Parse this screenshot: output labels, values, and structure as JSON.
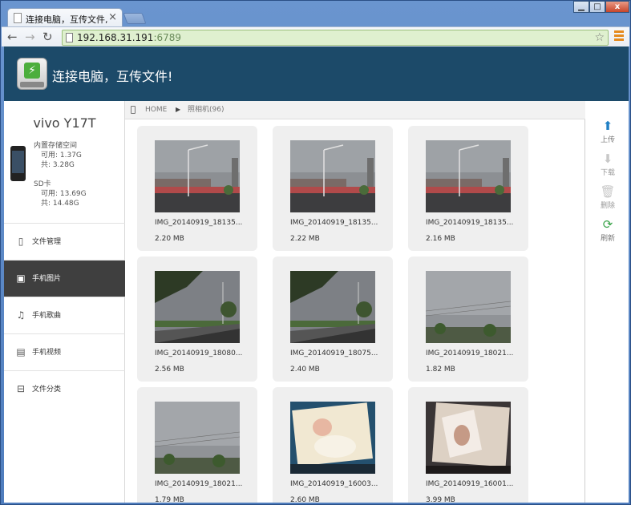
{
  "browser": {
    "tab_title": "连接电脑，互传文件,",
    "close_glyph": "×",
    "url_host": "192.168.31.191",
    "url_port": ":6789",
    "back_glyph": "←",
    "forward_glyph": "→",
    "reload_glyph": "↻",
    "star_glyph": "☆",
    "min_glyph": "▁",
    "max_glyph": "□",
    "close_win_glyph": "x"
  },
  "app": {
    "header_title": "连接电脑，互传文件!",
    "logo_glyph": "⚡",
    "device_name": "vivo Y17T",
    "internal_storage": {
      "label": "内置存储空间",
      "available": "可用: 1.37G",
      "total": "共: 3.28G"
    },
    "sd_card": {
      "label": "SD卡",
      "available": "可用: 13.69G",
      "total": "共: 14.48G"
    },
    "nav": [
      {
        "label": "文件管理",
        "icon": "phone-icon",
        "glyph": "▯"
      },
      {
        "label": "手机图片",
        "icon": "picture-icon",
        "glyph": "▣"
      },
      {
        "label": "手机歌曲",
        "icon": "music-note-icon",
        "glyph": "♫"
      },
      {
        "label": "手机视频",
        "icon": "film-icon",
        "glyph": "▤"
      },
      {
        "label": "文件分类",
        "icon": "inbox-icon",
        "glyph": "⊟"
      }
    ],
    "active_nav_index": 1,
    "breadcrumb": {
      "home": "HOME",
      "separator": "▶",
      "folder": "照相机(96)"
    },
    "files": [
      {
        "name": "IMG_20140919_18135...",
        "size": "2.20 MB",
        "scene": "city"
      },
      {
        "name": "IMG_20140919_18135...",
        "size": "2.22 MB",
        "scene": "city"
      },
      {
        "name": "IMG_20140919_18135...",
        "size": "2.16 MB",
        "scene": "city"
      },
      {
        "name": "IMG_20140919_18080...",
        "size": "2.56 MB",
        "scene": "tree"
      },
      {
        "name": "IMG_20140919_18075...",
        "size": "2.40 MB",
        "scene": "tree"
      },
      {
        "name": "IMG_20140919_18021...",
        "size": "1.82 MB",
        "scene": "sky"
      },
      {
        "name": "IMG_20140919_18021...",
        "size": "1.79 MB",
        "scene": "sky"
      },
      {
        "name": "IMG_20140919_16003...",
        "size": "2.60 MB",
        "scene": "baby"
      },
      {
        "name": "IMG_20140919_16001...",
        "size": "3.99 MB",
        "scene": "baby2"
      }
    ],
    "actions": [
      {
        "label": "上传",
        "icon": "upload-icon",
        "glyph": "⬆",
        "color": "#1f7fc4",
        "enabled": true
      },
      {
        "label": "下载",
        "icon": "download-icon",
        "glyph": "⬇",
        "color": "#c8c8c8",
        "enabled": false
      },
      {
        "label": "删除",
        "icon": "trash-icon",
        "glyph": "🗑",
        "color": "#c8c8c8",
        "enabled": false
      },
      {
        "label": "刷新",
        "icon": "refresh-icon",
        "glyph": "⟳",
        "color": "#3aa34a",
        "enabled": true
      }
    ],
    "colors": {
      "header_bg": "#1c4a69",
      "active_nav_bg": "#3f3f3f",
      "card_bg": "#efefef"
    }
  }
}
